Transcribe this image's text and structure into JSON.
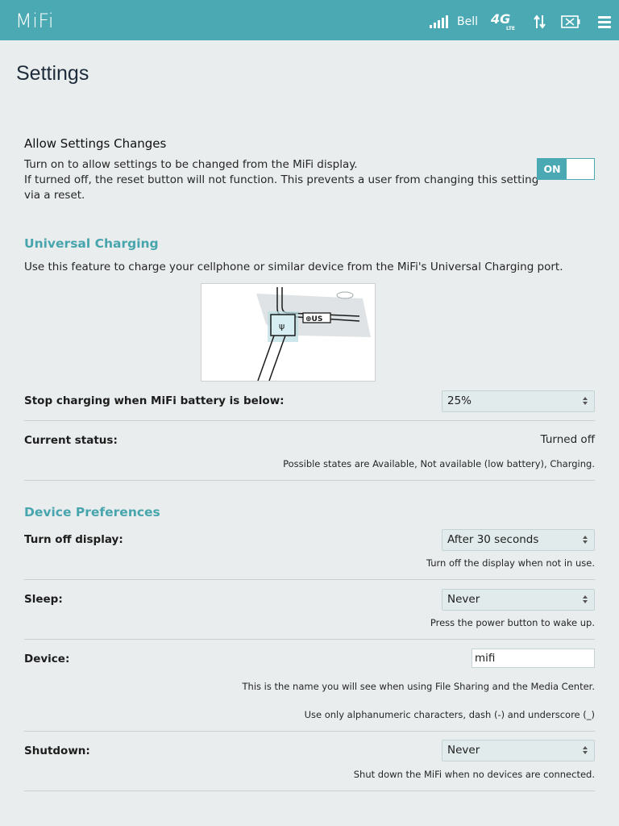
{
  "header": {
    "logo": "MiFi",
    "carrier": "Bell",
    "network": "4G",
    "network_sub": "LTE",
    "accent_color": "#4aa9b3",
    "icons": [
      "signal-bars-icon",
      "data-transfer-icon",
      "battery-empty-icon",
      "hamburger-menu-icon"
    ]
  },
  "page": {
    "title": "Settings"
  },
  "allow_changes": {
    "heading": "Allow Settings Changes",
    "line1": "Turn on to allow settings to be changed from the MiFi display.",
    "line2": "If turned off, the reset button will not function. This prevents a user from changing this setting",
    "line3": "via a reset.",
    "toggle_label": "ON",
    "toggle_state": true
  },
  "universal_charging": {
    "heading": "Universal Charging",
    "description": "Use this feature to charge your cellphone or similar device from the MiFi's Universal Charging port.",
    "stop_label": "Stop charging when MiFi battery is below:",
    "stop_value": "25%",
    "status_label": "Current status:",
    "status_value": "Turned off",
    "status_hint": "Possible states are Available, Not available (low battery), Charging."
  },
  "device_prefs": {
    "heading": "Device Preferences",
    "display_label": "Turn off display:",
    "display_value": "After 30 seconds",
    "display_hint": "Turn off the display when not in use.",
    "sleep_label": "Sleep:",
    "sleep_value": "Never",
    "sleep_hint": "Press the power button to wake up.",
    "device_label": "Device:",
    "device_value": "mifi",
    "device_hint1": "This is the name you will see when using File Sharing and the Media Center.",
    "device_hint2": "Use only alphanumeric characters, dash (-) and underscore (_)",
    "shutdown_label": "Shutdown:",
    "shutdown_value": "Never",
    "shutdown_hint": "Shut down the MiFi when no devices are connected."
  }
}
